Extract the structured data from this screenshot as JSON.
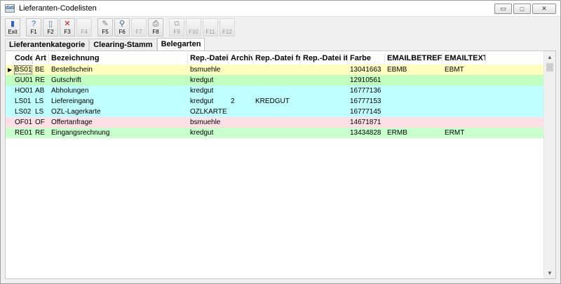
{
  "window": {
    "app_icon": "dati",
    "title": "Lieferanten-Codelisten",
    "minimize_glyph": "▭",
    "maximize_glyph": "□",
    "close_glyph": "✕"
  },
  "toolbar": [
    {
      "label": "Exit",
      "icon": "exit-door-icon",
      "glyph": "▮",
      "color": "#3060c0",
      "disabled": false
    },
    {
      "label": "F1",
      "icon": "help-icon",
      "glyph": "?",
      "color": "#1f5fc4",
      "disabled": false
    },
    {
      "label": "F2",
      "icon": "new-document-icon",
      "glyph": "▯",
      "color": "#5070a0",
      "disabled": false
    },
    {
      "label": "F3",
      "icon": "delete-x-icon",
      "glyph": "✕",
      "color": "#d01010",
      "disabled": false
    },
    {
      "label": "F4",
      "icon": "",
      "glyph": "",
      "color": "#9b9b9b",
      "disabled": true
    },
    {
      "label": "F5",
      "icon": "pin-icon",
      "glyph": "✎",
      "color": "#808080",
      "disabled": false
    },
    {
      "label": "F6",
      "icon": "search-magnifier-icon",
      "glyph": "⚲",
      "color": "#2a5f96",
      "disabled": false
    },
    {
      "label": "F7",
      "icon": "",
      "glyph": "",
      "color": "#9b9b9b",
      "disabled": true
    },
    {
      "label": "F8",
      "icon": "print-icon",
      "glyph": "⎙",
      "color": "#505050",
      "disabled": false
    },
    {
      "label": "F9",
      "icon": "copy-disabled-icon",
      "glyph": "⧉",
      "color": "#a8a8a8",
      "disabled": true
    },
    {
      "label": "F10",
      "icon": "",
      "glyph": "",
      "color": "#9b9b9b",
      "disabled": true
    },
    {
      "label": "F11",
      "icon": "",
      "glyph": "",
      "color": "#9b9b9b",
      "disabled": true
    },
    {
      "label": "F12",
      "icon": "",
      "glyph": "",
      "color": "#9b9b9b",
      "disabled": true
    }
  ],
  "tabs": [
    {
      "label": "Lieferantenkategorie",
      "active": false
    },
    {
      "label": "Clearing-Stamm",
      "active": false
    },
    {
      "label": "Belegarten",
      "active": true
    }
  ],
  "grid": {
    "columns": [
      "Code",
      "Art",
      "Bezeichnung",
      "Rep.-Datei",
      "Archiv",
      "Rep.-Datei fr.",
      "Rep.-Datei it.",
      "Farbe",
      "EMAILBETREFF",
      "EMAILTEXT"
    ],
    "current_row_marker": "▶",
    "rows": [
      {
        "bg": "#ffffc0",
        "cells": [
          "BS01",
          "BE",
          "Bestellschein",
          "bsmuehle",
          "",
          "",
          "",
          "13041663",
          "EBMB",
          "EBMT"
        ]
      },
      {
        "bg": "#c1ffc1",
        "cells": [
          "GU01",
          "RE",
          "Gutschrift",
          "kredgut",
          "",
          "",
          "",
          "12910561",
          "",
          ""
        ]
      },
      {
        "bg": "#c0ffff",
        "cells": [
          "HO01",
          "AB",
          "Abholungen",
          "kredgut",
          "",
          "",
          "",
          "16777136",
          "",
          ""
        ]
      },
      {
        "bg": "#c0ffff",
        "cells": [
          "LS01",
          "LS",
          "Liefereingang",
          "kredgut",
          "2",
          "KREDGUT",
          "",
          "16777153",
          "",
          ""
        ]
      },
      {
        "bg": "#c0ffff",
        "cells": [
          "LS02",
          "LS",
          "OZL-Lagerkarte",
          "OZLKARTE",
          "",
          "",
          "",
          "16777145",
          "",
          ""
        ]
      },
      {
        "bg": "#ffdfe6",
        "cells": [
          "OF01",
          "OF",
          "Offertanfrage",
          "bsmuehle",
          "",
          "",
          "",
          "14671871",
          "",
          ""
        ]
      },
      {
        "bg": "#c8ffcc",
        "cells": [
          "RE01",
          "RE",
          "Eingangsrechnung",
          "kredgut",
          "",
          "",
          "",
          "13434828",
          "ERMB",
          "ERMT"
        ]
      }
    ]
  },
  "scrollbar": {
    "up_glyph": "▲",
    "down_glyph": "▼"
  }
}
